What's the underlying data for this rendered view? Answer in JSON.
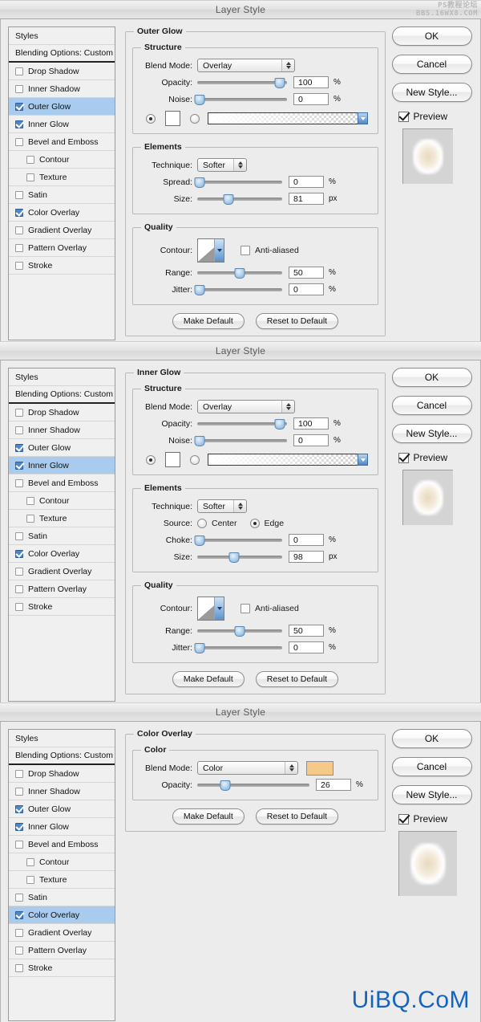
{
  "watermarks": {
    "top_line1": "PS教程论坛",
    "top_line2": "BBS.16WX8.COM",
    "bottom": "UiBQ.CoM",
    "bottom_color": "#1565c0"
  },
  "common": {
    "title": "Layer Style",
    "styles_header": "Styles",
    "blending_options": "Blending Options: Custom",
    "buttons": {
      "ok": "OK",
      "cancel": "Cancel",
      "new_style": "New Style...",
      "preview": "Preview",
      "make_default": "Make Default",
      "reset_to_default": "Reset to Default"
    },
    "effects": [
      {
        "label": "Drop Shadow",
        "checked": false,
        "indent": false
      },
      {
        "label": "Inner Shadow",
        "checked": false,
        "indent": false
      },
      {
        "label": "Outer Glow",
        "checked": true,
        "indent": false
      },
      {
        "label": "Inner Glow",
        "checked": true,
        "indent": false
      },
      {
        "label": "Bevel and Emboss",
        "checked": false,
        "indent": false
      },
      {
        "label": "Contour",
        "checked": false,
        "indent": true
      },
      {
        "label": "Texture",
        "checked": false,
        "indent": true
      },
      {
        "label": "Satin",
        "checked": false,
        "indent": false
      },
      {
        "label": "Color Overlay",
        "checked": true,
        "indent": false
      },
      {
        "label": "Gradient Overlay",
        "checked": false,
        "indent": false
      },
      {
        "label": "Pattern Overlay",
        "checked": false,
        "indent": false
      },
      {
        "label": "Stroke",
        "checked": false,
        "indent": false
      }
    ],
    "accent_selected": "#a8cbee"
  },
  "panel1": {
    "selected_effect": "Outer Glow",
    "group_title": "Outer Glow",
    "structure": {
      "legend": "Structure",
      "blend_mode_label": "Blend Mode:",
      "blend_mode_value": "Overlay",
      "opacity_label": "Opacity:",
      "opacity_value": "100",
      "opacity_unit": "%",
      "opacity_pct": 92,
      "noise_label": "Noise:",
      "noise_value": "0",
      "noise_unit": "%",
      "noise_pct": 2
    },
    "elements": {
      "legend": "Elements",
      "technique_label": "Technique:",
      "technique_value": "Softer",
      "spread_label": "Spread:",
      "spread_value": "0",
      "spread_unit": "%",
      "spread_pct": 2,
      "size_label": "Size:",
      "size_value": "81",
      "size_unit": "px",
      "size_pct": 37
    },
    "quality": {
      "legend": "Quality",
      "contour_label": "Contour:",
      "anti_aliased_label": "Anti-aliased",
      "anti_aliased_checked": false,
      "range_label": "Range:",
      "range_value": "50",
      "range_unit": "%",
      "range_pct": 50,
      "jitter_label": "Jitter:",
      "jitter_value": "0",
      "jitter_unit": "%",
      "jitter_pct": 2
    }
  },
  "panel2": {
    "selected_effect": "Inner Glow",
    "group_title": "Inner Glow",
    "structure": {
      "legend": "Structure",
      "blend_mode_label": "Blend Mode:",
      "blend_mode_value": "Overlay",
      "opacity_label": "Opacity:",
      "opacity_value": "100",
      "opacity_unit": "%",
      "opacity_pct": 92,
      "noise_label": "Noise:",
      "noise_value": "0",
      "noise_unit": "%",
      "noise_pct": 2
    },
    "elements": {
      "legend": "Elements",
      "technique_label": "Technique:",
      "technique_value": "Softer",
      "source_label": "Source:",
      "source_center_label": "Center",
      "source_edge_label": "Edge",
      "source_selected": "Edge",
      "choke_label": "Choke:",
      "choke_value": "0",
      "choke_unit": "%",
      "choke_pct": 2,
      "size_label": "Size:",
      "size_value": "98",
      "size_unit": "px",
      "size_pct": 43
    },
    "quality": {
      "legend": "Quality",
      "contour_label": "Contour:",
      "anti_aliased_label": "Anti-aliased",
      "anti_aliased_checked": false,
      "range_label": "Range:",
      "range_value": "50",
      "range_unit": "%",
      "range_pct": 50,
      "jitter_label": "Jitter:",
      "jitter_value": "0",
      "jitter_unit": "%",
      "jitter_pct": 2
    }
  },
  "panel3": {
    "selected_effect": "Color Overlay",
    "group_title": "Color Overlay",
    "color": {
      "legend": "Color",
      "blend_mode_label": "Blend Mode:",
      "blend_mode_value": "Color",
      "swatch_color": "#f5c98a",
      "opacity_label": "Opacity:",
      "opacity_value": "26",
      "opacity_unit": "%",
      "opacity_pct": 25
    }
  }
}
